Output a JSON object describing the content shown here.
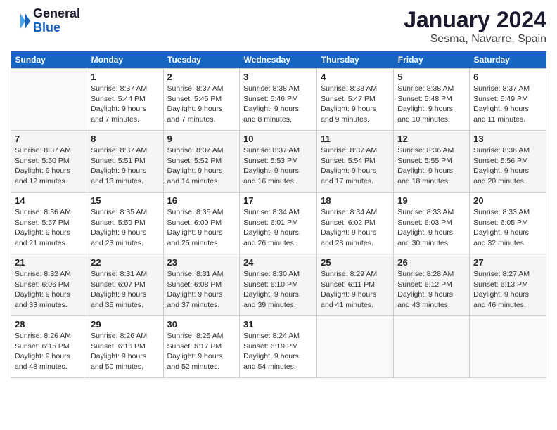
{
  "header": {
    "logo_line1": "General",
    "logo_line2": "Blue",
    "month": "January 2024",
    "location": "Sesma, Navarre, Spain"
  },
  "days_of_week": [
    "Sunday",
    "Monday",
    "Tuesday",
    "Wednesday",
    "Thursday",
    "Friday",
    "Saturday"
  ],
  "weeks": [
    [
      {
        "day": "",
        "info": ""
      },
      {
        "day": "1",
        "info": "Sunrise: 8:37 AM\nSunset: 5:44 PM\nDaylight: 9 hours\nand 7 minutes."
      },
      {
        "day": "2",
        "info": "Sunrise: 8:37 AM\nSunset: 5:45 PM\nDaylight: 9 hours\nand 7 minutes."
      },
      {
        "day": "3",
        "info": "Sunrise: 8:38 AM\nSunset: 5:46 PM\nDaylight: 9 hours\nand 8 minutes."
      },
      {
        "day": "4",
        "info": "Sunrise: 8:38 AM\nSunset: 5:47 PM\nDaylight: 9 hours\nand 9 minutes."
      },
      {
        "day": "5",
        "info": "Sunrise: 8:38 AM\nSunset: 5:48 PM\nDaylight: 9 hours\nand 10 minutes."
      },
      {
        "day": "6",
        "info": "Sunrise: 8:37 AM\nSunset: 5:49 PM\nDaylight: 9 hours\nand 11 minutes."
      }
    ],
    [
      {
        "day": "7",
        "info": "Sunrise: 8:37 AM\nSunset: 5:50 PM\nDaylight: 9 hours\nand 12 minutes."
      },
      {
        "day": "8",
        "info": "Sunrise: 8:37 AM\nSunset: 5:51 PM\nDaylight: 9 hours\nand 13 minutes."
      },
      {
        "day": "9",
        "info": "Sunrise: 8:37 AM\nSunset: 5:52 PM\nDaylight: 9 hours\nand 14 minutes."
      },
      {
        "day": "10",
        "info": "Sunrise: 8:37 AM\nSunset: 5:53 PM\nDaylight: 9 hours\nand 16 minutes."
      },
      {
        "day": "11",
        "info": "Sunrise: 8:37 AM\nSunset: 5:54 PM\nDaylight: 9 hours\nand 17 minutes."
      },
      {
        "day": "12",
        "info": "Sunrise: 8:36 AM\nSunset: 5:55 PM\nDaylight: 9 hours\nand 18 minutes."
      },
      {
        "day": "13",
        "info": "Sunrise: 8:36 AM\nSunset: 5:56 PM\nDaylight: 9 hours\nand 20 minutes."
      }
    ],
    [
      {
        "day": "14",
        "info": "Sunrise: 8:36 AM\nSunset: 5:57 PM\nDaylight: 9 hours\nand 21 minutes."
      },
      {
        "day": "15",
        "info": "Sunrise: 8:35 AM\nSunset: 5:59 PM\nDaylight: 9 hours\nand 23 minutes."
      },
      {
        "day": "16",
        "info": "Sunrise: 8:35 AM\nSunset: 6:00 PM\nDaylight: 9 hours\nand 25 minutes."
      },
      {
        "day": "17",
        "info": "Sunrise: 8:34 AM\nSunset: 6:01 PM\nDaylight: 9 hours\nand 26 minutes."
      },
      {
        "day": "18",
        "info": "Sunrise: 8:34 AM\nSunset: 6:02 PM\nDaylight: 9 hours\nand 28 minutes."
      },
      {
        "day": "19",
        "info": "Sunrise: 8:33 AM\nSunset: 6:03 PM\nDaylight: 9 hours\nand 30 minutes."
      },
      {
        "day": "20",
        "info": "Sunrise: 8:33 AM\nSunset: 6:05 PM\nDaylight: 9 hours\nand 32 minutes."
      }
    ],
    [
      {
        "day": "21",
        "info": "Sunrise: 8:32 AM\nSunset: 6:06 PM\nDaylight: 9 hours\nand 33 minutes."
      },
      {
        "day": "22",
        "info": "Sunrise: 8:31 AM\nSunset: 6:07 PM\nDaylight: 9 hours\nand 35 minutes."
      },
      {
        "day": "23",
        "info": "Sunrise: 8:31 AM\nSunset: 6:08 PM\nDaylight: 9 hours\nand 37 minutes."
      },
      {
        "day": "24",
        "info": "Sunrise: 8:30 AM\nSunset: 6:10 PM\nDaylight: 9 hours\nand 39 minutes."
      },
      {
        "day": "25",
        "info": "Sunrise: 8:29 AM\nSunset: 6:11 PM\nDaylight: 9 hours\nand 41 minutes."
      },
      {
        "day": "26",
        "info": "Sunrise: 8:28 AM\nSunset: 6:12 PM\nDaylight: 9 hours\nand 43 minutes."
      },
      {
        "day": "27",
        "info": "Sunrise: 8:27 AM\nSunset: 6:13 PM\nDaylight: 9 hours\nand 46 minutes."
      }
    ],
    [
      {
        "day": "28",
        "info": "Sunrise: 8:26 AM\nSunset: 6:15 PM\nDaylight: 9 hours\nand 48 minutes."
      },
      {
        "day": "29",
        "info": "Sunrise: 8:26 AM\nSunset: 6:16 PM\nDaylight: 9 hours\nand 50 minutes."
      },
      {
        "day": "30",
        "info": "Sunrise: 8:25 AM\nSunset: 6:17 PM\nDaylight: 9 hours\nand 52 minutes."
      },
      {
        "day": "31",
        "info": "Sunrise: 8:24 AM\nSunset: 6:19 PM\nDaylight: 9 hours\nand 54 minutes."
      },
      {
        "day": "",
        "info": ""
      },
      {
        "day": "",
        "info": ""
      },
      {
        "day": "",
        "info": ""
      }
    ]
  ]
}
